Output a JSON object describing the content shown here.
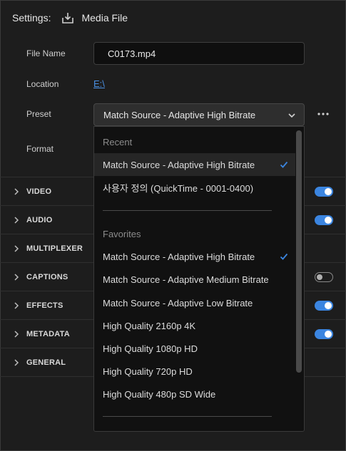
{
  "header": {
    "settings_label": "Settings:",
    "destination_label": "Media File"
  },
  "form": {
    "file_name_label": "File Name",
    "file_name_value": "C0173.mp4",
    "location_label": "Location",
    "location_value": "E:\\",
    "preset_label": "Preset",
    "preset_value": "Match Source - Adaptive High Bitrate",
    "format_label": "Format"
  },
  "sections": [
    {
      "label": "VIDEO",
      "toggle": "on"
    },
    {
      "label": "AUDIO",
      "toggle": "on"
    },
    {
      "label": "MULTIPLEXER",
      "toggle": "none"
    },
    {
      "label": "CAPTIONS",
      "toggle": "off"
    },
    {
      "label": "EFFECTS",
      "toggle": "on"
    },
    {
      "label": "METADATA",
      "toggle": "on"
    },
    {
      "label": "GENERAL",
      "toggle": "none"
    }
  ],
  "dropdown": {
    "recent_header": "Recent",
    "recent_items": [
      {
        "label": "Match Source - Adaptive High Bitrate",
        "checked": true
      },
      {
        "label": "사용자 정의 (QuickTime - 0001-0400)",
        "checked": false
      }
    ],
    "favorites_header": "Favorites",
    "favorite_items": [
      {
        "label": "Match Source - Adaptive High Bitrate",
        "checked": true
      },
      {
        "label": "Match Source - Adaptive Medium Bitrate",
        "checked": false
      },
      {
        "label": "Match Source - Adaptive Low Bitrate",
        "checked": false
      },
      {
        "label": "High Quality 2160p 4K",
        "checked": false
      },
      {
        "label": "High Quality 1080p HD",
        "checked": false
      },
      {
        "label": "High Quality 720p HD",
        "checked": false
      },
      {
        "label": "High Quality 480p SD Wide",
        "checked": false
      }
    ]
  },
  "colors": {
    "accent": "#3b85e0",
    "link": "#4a90e2",
    "background": "#1d1d1d"
  },
  "icons": [
    "export-icon",
    "chevron-down-icon",
    "more-icon",
    "chevron-right-icon",
    "checkmark-icon"
  ]
}
